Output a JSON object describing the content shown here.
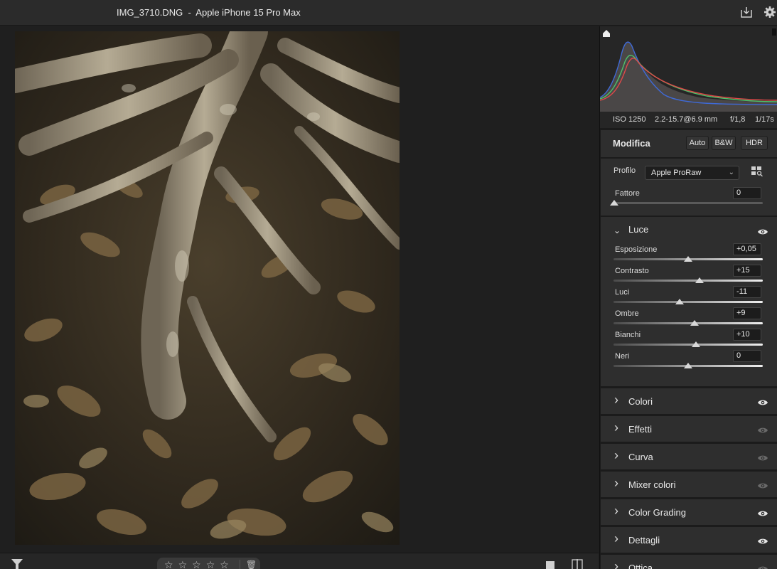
{
  "window": {
    "filename": "IMG_3710.DNG",
    "separator": "-",
    "camera": "Apple iPhone 15 Pro Max"
  },
  "toolbar_icons": [
    "save-download-icon",
    "gear-icon"
  ],
  "histogram": {
    "channels": [
      "blue",
      "green",
      "red"
    ],
    "iso": "ISO 1250",
    "lens": "2.2-15.7@6.9 mm",
    "aperture": "f/1,8",
    "shutter": "1/17s"
  },
  "edit": {
    "title": "Modifica",
    "auto_label": "Auto",
    "bw_label": "B&W",
    "hdr_label": "HDR",
    "profile_label": "Profilo",
    "profile_value": "Apple ProRaw",
    "amount_label": "Fattore",
    "amount_value": "0",
    "amount_level": 0
  },
  "light": {
    "title": "Luce",
    "sliders": [
      {
        "label": "Esposizione",
        "value": "+0,05",
        "level": 0.5
      },
      {
        "label": "Contrasto",
        "value": "+15",
        "level": 0.575
      },
      {
        "label": "Luci",
        "value": "-11",
        "level": 0.445
      },
      {
        "label": "Ombre",
        "value": "+9",
        "level": 0.545
      },
      {
        "label": "Bianchi",
        "value": "+10",
        "level": 0.55
      },
      {
        "label": "Neri",
        "value": "0",
        "level": 0.5
      }
    ]
  },
  "sections": [
    {
      "label": "Colori",
      "visible": true
    },
    {
      "label": "Effetti",
      "visible": false
    },
    {
      "label": "Curva",
      "visible": false
    },
    {
      "label": "Mixer colori",
      "visible": false
    },
    {
      "label": "Color Grading",
      "visible": true
    },
    {
      "label": "Dettagli",
      "visible": true
    },
    {
      "label": "Ottica",
      "visible": false
    }
  ],
  "rating": {
    "stars": 0,
    "max": 5
  }
}
